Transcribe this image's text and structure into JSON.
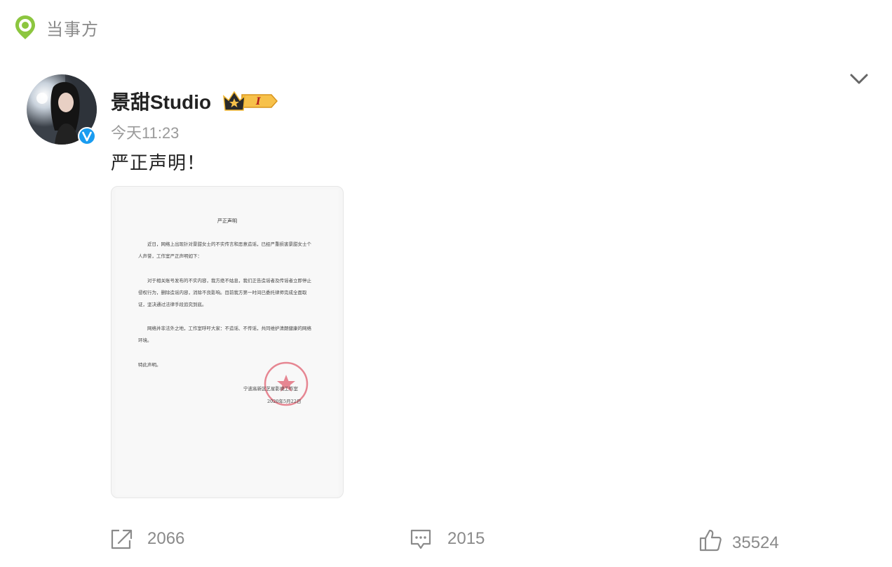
{
  "top_tag": {
    "label": "当事方",
    "icon": "location-pin-icon",
    "color": "#8cc63f"
  },
  "post": {
    "author": "景甜Studio",
    "verified": true,
    "time": "今天11:23",
    "text": "严正声明！"
  },
  "document": {
    "title": "严正声明",
    "paragraphs": [
      "近日，网络上出现针对景甜女士的不实传言和恶意造谣，已经严重损害景甜女士个人声誉，工作室严正声明如下：",
      "对于相关账号发布的不实内容，我方绝不姑息，我们正告造谣者及传谣者立即停止侵权行为，删除造谣内容，消除不良影响。目前我方第一时间已委托律师完成全面取证，坚决通过法律手段追究到底。",
      "网络并非法外之地，工作室呼吁大家：不造谣、不传谣，共同维护清朗健康的网络环境。",
      "特此声明。"
    ],
    "issuer": "宁波高新区艺星影视工作室",
    "date": "2020年5月22日"
  },
  "actions": {
    "repost": {
      "count": "2066",
      "icon": "share-icon"
    },
    "comment": {
      "count": "2015",
      "icon": "comment-icon"
    },
    "like": {
      "count": "35524",
      "icon": "thumbs-up-icon"
    }
  },
  "colors": {
    "tag_green": "#8cc63f",
    "verified_blue": "#1a9cf0",
    "seal_red": "#e06070",
    "icon_gray": "#8a8a8a"
  }
}
